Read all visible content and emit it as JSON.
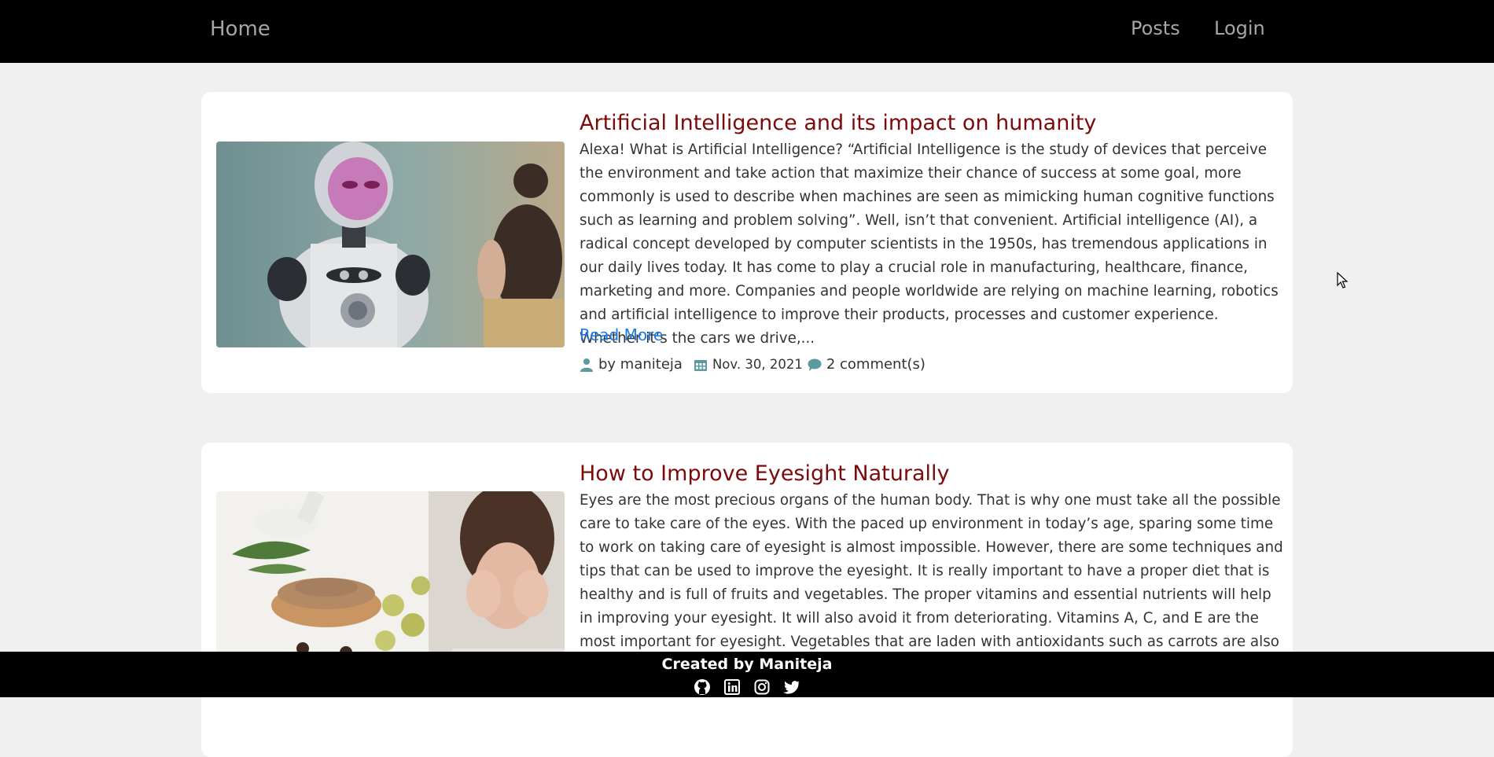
{
  "navbar": {
    "home_label": "Home",
    "posts_label": "Posts",
    "login_label": "Login"
  },
  "posts": [
    {
      "title": "Artificial Intelligence and its impact on humanity",
      "excerpt": "Alexa! What is Artificial Intelligence? “Artificial Intelligence is the study of devices that perceive the environment and take action that maximize their chance of success at some goal, more commonly is used to describe when machines are seen as mimicking human cognitive functions such as learning and problem solving”. Well, isn’t that convenient. Artificial intelligence (AI), a radical concept developed by computer scientists in the 1950s, has tremendous applications in our daily lives today. It has come to play a crucial role in manufacturing, healthcare, finance, marketing and more. Companies and people worldwide are relying on machine learning, robotics and artificial intelligence to improve their products, processes and customer experience. Whether it’s the cars we drive,...",
      "read_more": "Read More",
      "author": "by maniteja",
      "date": "Nov. 30, 2021",
      "comments": "2 comment(s)"
    },
    {
      "title": "How to Improve Eyesight Naturally",
      "excerpt": "Eyes are the most precious organs of the human body. That is why one must take all the possible care to take care of the eyes. With the paced up environment in today’s age, sparing some time to work on taking care of eyesight is almost impossible. However, there are some techniques and tips that can be used to improve the eyesight. It is really important to have a proper diet that is healthy and is full of fruits and vegetables. The proper vitamins and essential nutrients will help in improving your eyesight. It will also avoid it from deteriorating. Vitamins A, C, and E are the most important for eyesight. Vegetables that are laden with antioxidants such as carrots are also a wonderful bank of"
    }
  ],
  "footer": {
    "credit": "Created by Maniteja",
    "social_icons": [
      "github-icon",
      "linkedin-icon",
      "instagram-icon",
      "twitter-icon"
    ]
  },
  "colors": {
    "title": "#7c0a0a",
    "link": "#1a7ae8",
    "meta_icon": "#5b9aa0",
    "nav_text": "#a6a6a6"
  }
}
